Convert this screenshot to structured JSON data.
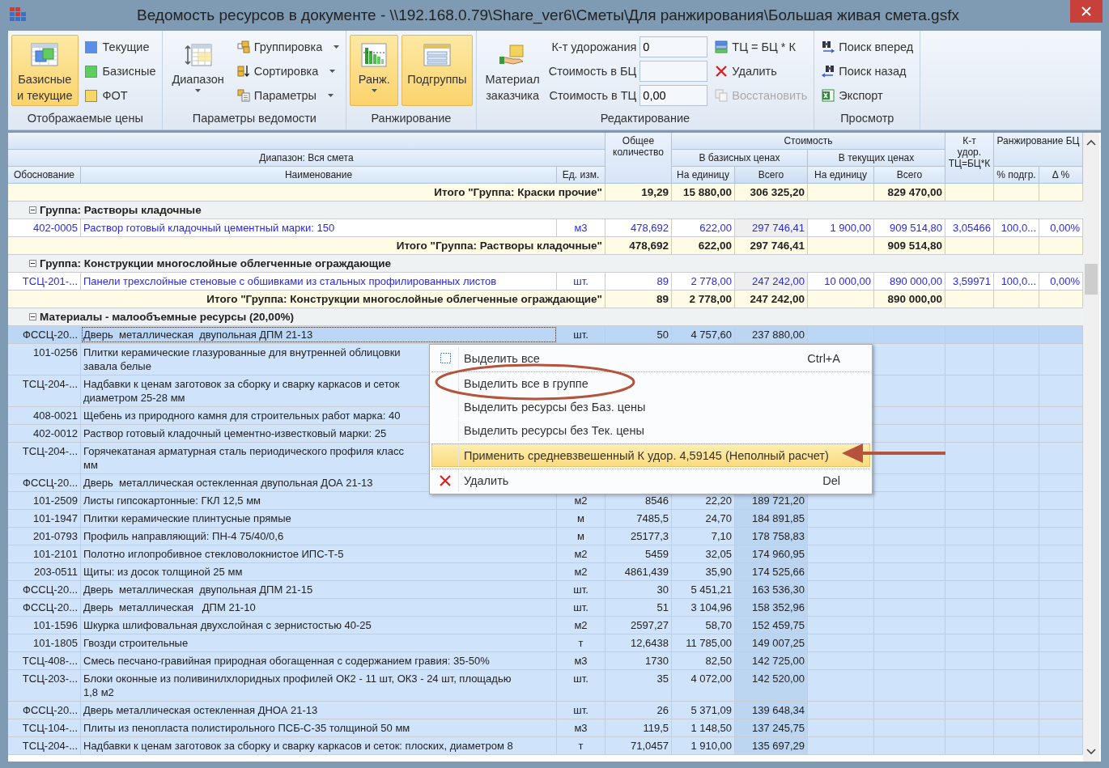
{
  "window": {
    "title": "Ведомость ресурсов в документе - \\\\192.168.0.79\\Share_ver6\\Сметы\\Для ранжирования\\Большая живая смета.gsfx"
  },
  "ribbon": [
    {
      "label": "Отображаемые цены",
      "columns": [
        [
          {
            "kind": "large",
            "label": "Базисные\nи текущие",
            "selected": true,
            "dropdown": false
          }
        ],
        [
          {
            "kind": "swatch",
            "label": "Текущие",
            "color": "#5b8ee6"
          },
          {
            "kind": "swatch",
            "label": "Базисные",
            "color": "#5fcc5f"
          },
          {
            "kind": "swatch",
            "label": "ФОТ",
            "color": "#f5d76a"
          }
        ]
      ]
    },
    {
      "label": "Параметры ведомости",
      "columns": [
        [
          {
            "kind": "large",
            "label": "Диапазон",
            "selected": false,
            "dropdown": true
          }
        ],
        [
          {
            "kind": "small",
            "label": "Группировка",
            "dropdown": true,
            "disabled": false
          },
          {
            "kind": "small",
            "label": "Сортировка",
            "dropdown": true,
            "disabled": false
          },
          {
            "kind": "small",
            "label": "Параметры",
            "dropdown": true,
            "disabled": false
          }
        ]
      ]
    },
    {
      "label": "Ранжирование",
      "columns": [
        [
          {
            "kind": "large",
            "label": "Ранж.",
            "selected": true,
            "dropdown": true
          }
        ],
        [
          {
            "kind": "large",
            "label": "Подгруппы",
            "selected": true,
            "dropdown": false
          }
        ]
      ]
    },
    {
      "label": "Редактирование",
      "columns": [
        [
          {
            "kind": "large",
            "label": "Материал\nзаказчика",
            "selected": false,
            "dropdown": false
          }
        ],
        [
          {
            "kind": "field",
            "label": "К-т удорожания",
            "value": "0"
          },
          {
            "kind": "field",
            "label": "Стоимость в БЦ"
          },
          {
            "kind": "field",
            "label": "Стоимость в ТЦ",
            "value": "0,00"
          }
        ],
        [
          {
            "kind": "small",
            "label": "ТЦ = БЦ * К",
            "dropdown": false,
            "disabled": false
          },
          {
            "kind": "small",
            "label": "Удалить",
            "dropdown": false,
            "disabled": false
          },
          {
            "kind": "small",
            "label": "Восстановить",
            "dropdown": false,
            "disabled": true
          }
        ]
      ]
    },
    {
      "label": "Просмотр",
      "columns": [
        [
          {
            "kind": "small",
            "label": "Поиск вперед",
            "dropdown": false,
            "disabled": false
          },
          {
            "kind": "small",
            "label": "Поиск назад",
            "dropdown": false,
            "disabled": false
          },
          {
            "kind": "small",
            "label": "Экспорт",
            "dropdown": false,
            "disabled": false
          }
        ]
      ]
    }
  ],
  "grid": {
    "header": {
      "range": "Диапазон: Вся смета",
      "cost": "Стоимость",
      "base": "В базисных ценах",
      "current": "В текущих ценах",
      "ranking": "Ранжирование БЦ",
      "columns": [
        {
          "label": "Обоснование",
          "shaded": false
        },
        {
          "label": "Наименование",
          "shaded": false
        },
        {
          "label": "Ед. изм.",
          "shaded": false
        },
        {
          "label": "Общее количество",
          "shaded": false
        },
        {
          "label": "На единицу",
          "shaded": false
        },
        {
          "label": "Всего",
          "shaded": true
        },
        {
          "label": "На единицу",
          "shaded": false
        },
        {
          "label": "Всего",
          "shaded": false
        },
        {
          "label": "К-т\nудор.\nТЦ=БЦ*К",
          "shaded": false
        },
        {
          "label": "% подгр.",
          "shaded": false
        },
        {
          "label": "Δ %",
          "shaded": false
        }
      ]
    },
    "rows": [
      {
        "kind": "total",
        "label": "Итого \"Группа: Краски прочие\"",
        "qty": "19,29",
        "base_unit": "15 880,00",
        "base_total": "306 325,20",
        "cur_total": "829 470,00"
      },
      {
        "kind": "group",
        "label": "Группа: Растворы кладочные",
        "expanded": true
      },
      {
        "kind": "priced",
        "selected": false,
        "focused": false,
        "code": "402-0005",
        "name": "Раствор готовый кладочный цементный марки: 150",
        "unit": "м3",
        "qty": "478,692",
        "base_unit": "622,00",
        "base_total": "297 746,41",
        "cur_unit": "1 900,00",
        "cur_total": "909 514,80",
        "k": "3,05466",
        "pct": "100,0...",
        "delta": "0,00%"
      },
      {
        "kind": "total",
        "label": "Итого \"Группа: Растворы кладочные\"",
        "qty": "478,692",
        "base_unit": "622,00",
        "base_total": "297 746,41",
        "cur_total": "909 514,80"
      },
      {
        "kind": "group",
        "label": "Группа: Конструкции многослойные облегченные ограждающие",
        "expanded": true
      },
      {
        "kind": "priced",
        "selected": false,
        "focused": false,
        "code": "ТСЦ-201-...",
        "name": "Панели трехслойные стеновые с обшивками из стальных профилированных листов",
        "unit": "шт.",
        "qty": "89",
        "base_unit": "2 778,00",
        "base_total": "247 242,00",
        "cur_unit": "10 000,00",
        "cur_total": "890 000,00",
        "k": "3,59971",
        "pct": "100,0...",
        "delta": "0,00%"
      },
      {
        "kind": "total",
        "label": "Итого \"Группа: Конструкции многослойные облегченные ограждающие\"",
        "qty": "89",
        "base_unit": "2 778,00",
        "base_total": "247 242,00",
        "cur_total": "890 000,00"
      },
      {
        "kind": "group",
        "label": "Материалы - малообъемные ресурсы (20,00%)",
        "expanded": true
      },
      {
        "kind": "material",
        "selected": true,
        "focused": true,
        "code": "ФССЦ-20...",
        "name": "Дверь  металлическая  двупольная ДПМ 21-13",
        "unit": "шт.",
        "qty": "50",
        "base_unit": "4 757,60",
        "base_total": "237 880,00"
      },
      {
        "kind": "material",
        "selected": true,
        "focused": false,
        "code": "101-0256",
        "name": "Плитки керамические глазурованные для внутренней облицовки\nзавала белые"
      },
      {
        "kind": "material",
        "selected": true,
        "focused": false,
        "code": "ТСЦ-204-...",
        "name": "Надбавки к ценам заготовок за сборку и сварку каркасов и сеток\nдиаметром 25-28 мм"
      },
      {
        "kind": "material",
        "selected": true,
        "focused": false,
        "code": "408-0021",
        "name": "Щебень из природного камня для строительных работ марка: 40"
      },
      {
        "kind": "material",
        "selected": true,
        "focused": false,
        "code": "402-0012",
        "name": "Раствор готовый кладочный цементно-известковый марки: 25"
      },
      {
        "kind": "material",
        "selected": true,
        "focused": false,
        "code": "ТСЦ-204-...",
        "name": "Горячекатаная арматурная сталь периодического профиля класс\nмм"
      },
      {
        "kind": "material",
        "selected": true,
        "focused": false,
        "code": "ФССЦ-20...",
        "name": "Дверь  металлическая остекленная двупольная ДОА 21-13"
      },
      {
        "kind": "material",
        "selected": true,
        "focused": false,
        "code": "101-2509",
        "name": "Листы гипсокартонные: ГКЛ 12,5 мм",
        "unit": "м2",
        "qty": "8546",
        "base_unit": "22,20",
        "base_total": "189 721,20"
      },
      {
        "kind": "material",
        "selected": true,
        "focused": false,
        "code": "101-1947",
        "name": "Плитки керамические плинтусные прямые",
        "unit": "м",
        "qty": "7485,5",
        "base_unit": "24,70",
        "base_total": "184 891,85"
      },
      {
        "kind": "material",
        "selected": true,
        "focused": false,
        "code": "201-0793",
        "name": "Профиль направляющий: ПН-4 75/40/0,6",
        "unit": "м",
        "qty": "25177,3",
        "base_unit": "7,10",
        "base_total": "178 758,83"
      },
      {
        "kind": "material",
        "selected": true,
        "focused": false,
        "code": "101-2101",
        "name": "Полотно иглопробивное стекловолокнистое ИПС-Т-5",
        "unit": "м2",
        "qty": "5459",
        "base_unit": "32,05",
        "base_total": "174 960,95"
      },
      {
        "kind": "material",
        "selected": true,
        "focused": false,
        "code": "203-0511",
        "name": "Щиты: из досок толщиной 25 мм",
        "unit": "м2",
        "qty": "4861,439",
        "base_unit": "35,90",
        "base_total": "174 525,66"
      },
      {
        "kind": "material",
        "selected": true,
        "focused": false,
        "code": "ФССЦ-20...",
        "name": "Дверь  металлическая  двупольная ДПМ 21-15",
        "unit": "шт.",
        "qty": "30",
        "base_unit": "5 451,21",
        "base_total": "163 536,30"
      },
      {
        "kind": "material",
        "selected": true,
        "focused": false,
        "code": "ФССЦ-20...",
        "name": "Дверь  металлическая   ДПМ 21-10",
        "unit": "шт.",
        "qty": "51",
        "base_unit": "3 104,96",
        "base_total": "158 352,96"
      },
      {
        "kind": "material",
        "selected": true,
        "focused": false,
        "code": "101-1596",
        "name": "Шкурка шлифовальная двухслойная с зернистостью 40-25",
        "unit": "м2",
        "qty": "2597,27",
        "base_unit": "58,70",
        "base_total": "152 459,75"
      },
      {
        "kind": "material",
        "selected": true,
        "focused": false,
        "code": "101-1805",
        "name": "Гвозди строительные",
        "unit": "т",
        "qty": "12,6438",
        "base_unit": "11 785,00",
        "base_total": "149 007,25"
      },
      {
        "kind": "material",
        "selected": true,
        "focused": false,
        "code": "ТСЦ-408-...",
        "name": "Смесь песчано-гравийная природная обогащенная с содержанием гравия: 35-50%",
        "unit": "м3",
        "qty": "1730",
        "base_unit": "82,50",
        "base_total": "142 725,00"
      },
      {
        "kind": "material",
        "selected": true,
        "focused": false,
        "code": "ТСЦ-203-...",
        "name": "Блоки оконные из поливинилхлоридных профилей ОК2 - 11 шт, ОК3 - 24 шт, площадью\n1,8 м2",
        "unit": "шт.",
        "qty": "35",
        "base_unit": "4 072,00",
        "base_total": "142 520,00"
      },
      {
        "kind": "material",
        "selected": true,
        "focused": false,
        "code": "ФССЦ-20...",
        "name": "Дверь металлическая остекленная ДНОА 21-13",
        "unit": "шт.",
        "qty": "26",
        "base_unit": "5 371,09",
        "base_total": "139 648,34"
      },
      {
        "kind": "material",
        "selected": true,
        "focused": false,
        "code": "ТСЦ-104-...",
        "name": "Плиты из пенопласта полистирольного ПСБ-С-35 толщиной 50 мм",
        "unit": "м3",
        "qty": "119,5",
        "base_unit": "1 148,50",
        "base_total": "137 245,75"
      },
      {
        "kind": "material",
        "selected": true,
        "focused": false,
        "code": "ТСЦ-204-...",
        "name": "Надбавки к ценам заготовок за сборку и сварку каркасов и сеток: плоских, диаметром 8",
        "unit": "т",
        "qty": "71,0457",
        "base_unit": "1 910,00",
        "base_total": "135 697,29"
      }
    ]
  },
  "context_menu": {
    "items": [
      {
        "label": "Выделить все",
        "shortcut": "Ctrl+A",
        "highlighted": false,
        "separator_before": false
      },
      {
        "label": "Выделить все в группе",
        "highlighted": false,
        "separator_before": true
      },
      {
        "label": "Выделить ресурсы без Баз. цены",
        "highlighted": false,
        "separator_before": false
      },
      {
        "label": "Выделить ресурсы без Тек. цены",
        "highlighted": false,
        "separator_before": false
      },
      {
        "label": "Применить средневзвешенный К удор. 4,59145 (Неполный расчет)",
        "highlighted": true,
        "separator_before": true
      },
      {
        "label": "Удалить",
        "shortcut": "Del",
        "highlighted": false,
        "separator_before": true
      }
    ]
  }
}
